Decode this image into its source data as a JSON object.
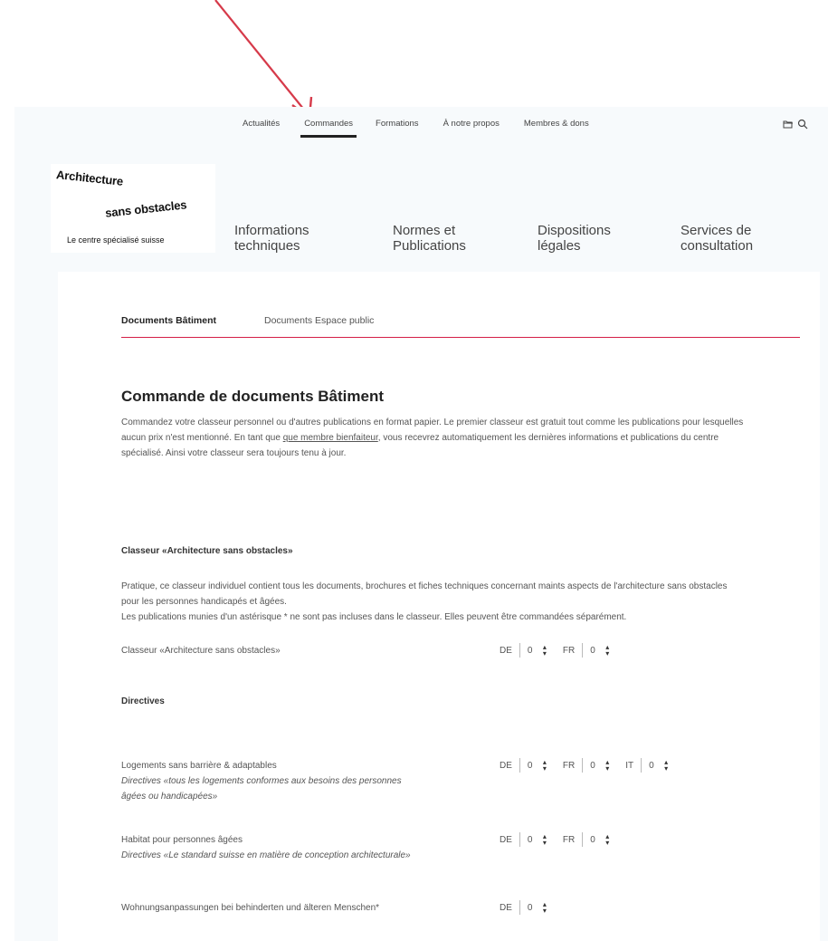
{
  "colors": {
    "accent": "#d41e47",
    "arrow": "#d63a4a",
    "text": "#333333"
  },
  "top_nav": {
    "items": [
      "Actualités",
      "Commandes",
      "Formations",
      "À notre propos",
      "Membres & dons"
    ],
    "active": "Commandes",
    "icons": [
      "folder-icon",
      "search-icon"
    ]
  },
  "logo": {
    "line1": "Architecture",
    "line2": "sans obstacles",
    "line3": "Le centre spécialisé suisse"
  },
  "main_nav": {
    "items": [
      "Informations\ntechniques",
      "Normes et\nPublications",
      "Dispositions\nlégales",
      "Services de\nconsultation"
    ]
  },
  "tabs": {
    "items": [
      "Documents Bâtiment",
      "Documents Espace public"
    ],
    "active": "Documents Bâtiment"
  },
  "content": {
    "title": "Commande de documents Bâtiment",
    "intro_before": "Commandez votre classeur personnel ou d'autres publications en format papier. Le premier classeur est gratuit tout comme les publications pour lesquelles aucun prix n'est mentionné. En tant que ",
    "intro_link": "que membre bienfaiteur",
    "intro_after": ", vous recevrez automatiquement les dernières informations et publications du centre spécialisé. Ainsi votre classeur sera toujours tenu à jour.",
    "section1": {
      "title": "Classeur «Architecture sans obstacles»",
      "para1": "Pratique, ce classeur individuel contient tous les documents, brochures et fiches techniques concernant maints aspects de l'architecture sans obstacles pour les personnes handicapés et âgées.",
      "para2": "Les publications munies d'un astérisque * ne sont pas incluses dans le classeur. Elles peuvent être commandées séparément.",
      "product": {
        "name": "Classeur «Architecture sans obstacles»",
        "qty": [
          {
            "lang": "DE",
            "value": "0"
          },
          {
            "lang": "FR",
            "value": "0"
          }
        ]
      }
    },
    "section2": {
      "title": "Directives",
      "products": [
        {
          "name": "Logements sans barrière & adaptables",
          "sub": "Directives «tous les logements conformes aux besoins des personnes âgées ou handicapées»",
          "qty": [
            {
              "lang": "DE",
              "value": "0"
            },
            {
              "lang": "FR",
              "value": "0"
            },
            {
              "lang": "IT",
              "value": "0"
            }
          ]
        },
        {
          "name": "Habitat pour personnes âgées",
          "sub": "Directives «Le standard suisse en matière de conception architecturale»",
          "qty": [
            {
              "lang": "DE",
              "value": "0"
            },
            {
              "lang": "FR",
              "value": "0"
            }
          ]
        },
        {
          "name": "Wohnungsanpassungen bei behinderten und älteren Menschen*",
          "sub": "",
          "qty": [
            {
              "lang": "DE",
              "value": "0"
            }
          ]
        }
      ]
    }
  }
}
